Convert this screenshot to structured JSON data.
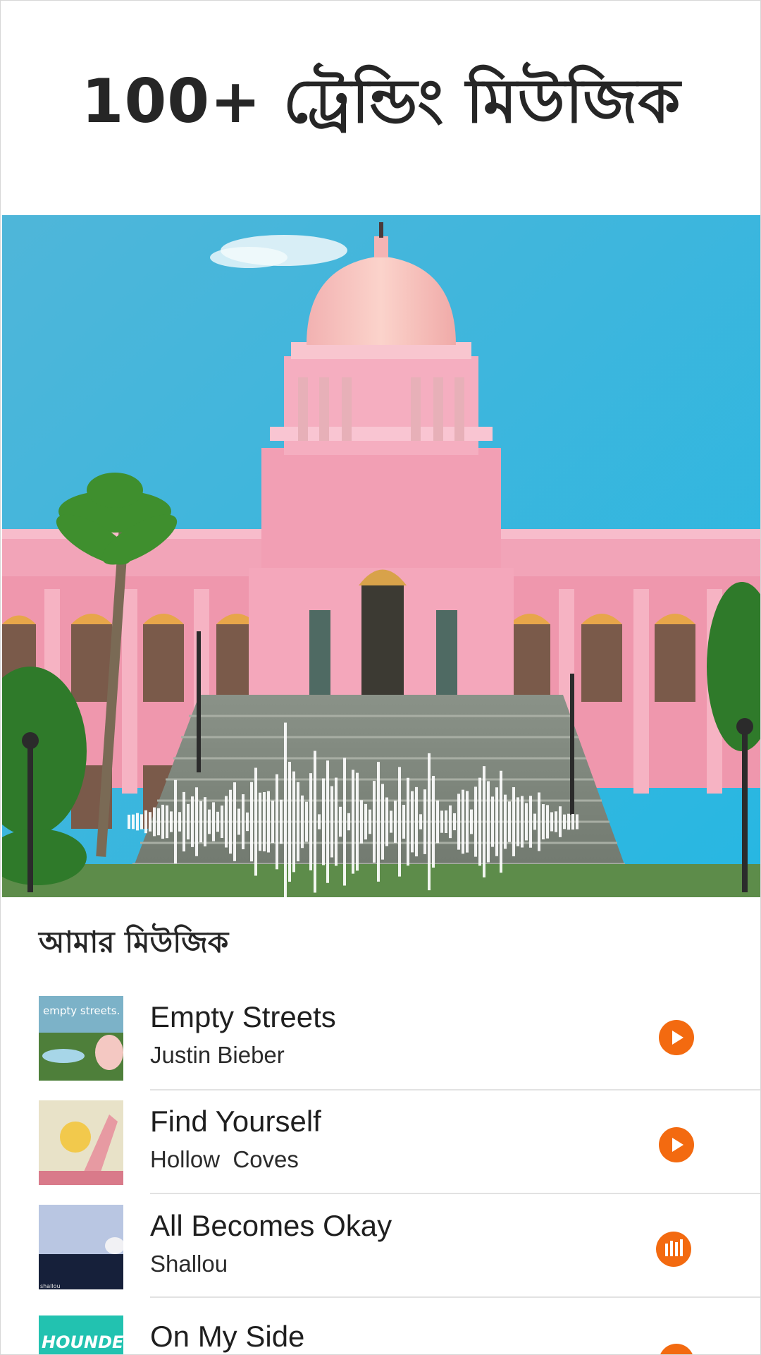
{
  "headline": "100+ ট্রেন্ডিং মিউজিক",
  "section_title": "আমার মিউজিক",
  "accent_color": "#f36a10",
  "fab": {
    "icon": "music-note-icon"
  },
  "tracks": [
    {
      "title": "Empty Streets",
      "artist": "Justin Bieber",
      "thumb_text": "empty streets.",
      "state": "play"
    },
    {
      "title": "Find Yourself",
      "artist": "Hollow  Coves",
      "thumb_text": "",
      "state": "play"
    },
    {
      "title": "All Becomes Okay",
      "artist": "Shallou",
      "thumb_text": "shallou",
      "state": "playing"
    },
    {
      "title": "On My Side",
      "artist": "",
      "thumb_text": "HOUNDED",
      "state": "play"
    }
  ]
}
